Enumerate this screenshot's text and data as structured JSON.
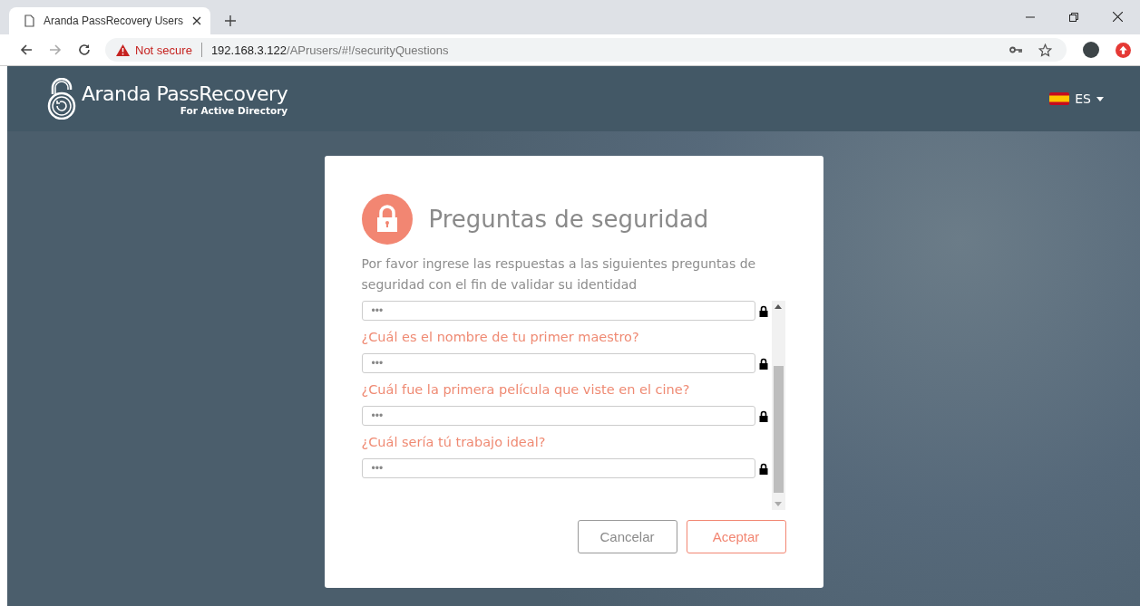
{
  "browser": {
    "tab_title": "Aranda PassRecovery Users",
    "security_label": "Not secure",
    "url_host": "192.168.3.122",
    "url_path": "/APrusers/#!/securityQuestions"
  },
  "header": {
    "brand_light": "Aranda",
    "brand_bold": "PassRecovery",
    "brand_sub": "For Active Directory",
    "language": "ES"
  },
  "card": {
    "title": "Preguntas de seguridad",
    "description": "Por favor ingrese las respuestas a las siguientes preguntas de seguridad con el fin de validar su identidad",
    "questions": [
      {
        "placeholder": "•••"
      },
      {
        "question": "¿Cuál es el nombre de tu primer maestro?",
        "placeholder": "•••"
      },
      {
        "question": "¿Cuál fue la primera película que viste en el cine?",
        "placeholder": "•••"
      },
      {
        "question": "¿Cuál sería tú trabajo ideal?",
        "placeholder": "•••"
      }
    ],
    "buttons": [
      {
        "label": "Cancelar",
        "kind": "secondary"
      },
      {
        "label": "Aceptar",
        "kind": "primary"
      }
    ]
  }
}
